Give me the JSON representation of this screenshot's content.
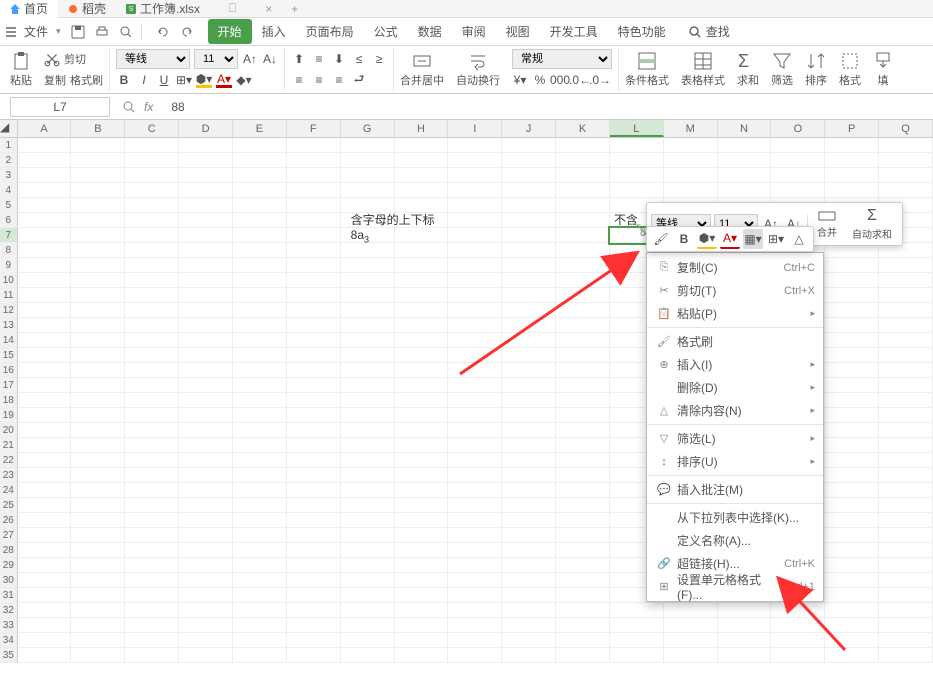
{
  "tabs": {
    "home": "首页",
    "daoke": "稻壳",
    "workbook": "工作簿.xlsx"
  },
  "menu": {
    "file": "文件",
    "tabs": [
      "开始",
      "插入",
      "页面布局",
      "公式",
      "数据",
      "审阅",
      "视图",
      "开发工具",
      "特色功能"
    ],
    "search": "查找"
  },
  "ribbon": {
    "paste": "粘贴",
    "cut": "剪切",
    "copy": "复制",
    "format_painter": "格式刷",
    "font_name": "等线",
    "font_size": "11",
    "number_format": "常规",
    "merge_center": "合并居中",
    "auto_wrap": "自动换行",
    "cond_format": "条件格式",
    "table_style": "表格样式",
    "sum": "求和",
    "filter": "筛选",
    "sort": "排序",
    "format": "格式",
    "fill": "填"
  },
  "formula_bar": {
    "name_box": "L7",
    "value": "88"
  },
  "columns": [
    "A",
    "B",
    "C",
    "D",
    "E",
    "F",
    "G",
    "H",
    "I",
    "J",
    "K",
    "L",
    "M",
    "N",
    "O",
    "P",
    "Q"
  ],
  "selected_col": "L",
  "selected_row": 7,
  "cells": {
    "G6": "含字母的上下标",
    "G7_prefix": "8a",
    "G7_sub": "3",
    "L6": "不含",
    "L7_display": "88|"
  },
  "mini_toolbar": {
    "font_name": "等线",
    "font_size": "11",
    "merge": "合并",
    "autosum": "自动求和"
  },
  "context_menu": {
    "items": [
      {
        "icon": "copy",
        "label": "复制(C)",
        "shortcut": "Ctrl+C"
      },
      {
        "icon": "cut",
        "label": "剪切(T)",
        "shortcut": "Ctrl+X"
      },
      {
        "icon": "paste",
        "label": "粘贴(P)",
        "arrow": true
      },
      {
        "divider": true
      },
      {
        "icon": "brush",
        "label": "格式刷"
      },
      {
        "icon": "insert",
        "label": "插入(I)",
        "arrow": true
      },
      {
        "icon": "",
        "label": "删除(D)",
        "arrow": true
      },
      {
        "icon": "clear",
        "label": "清除内容(N)",
        "arrow": true
      },
      {
        "divider": true
      },
      {
        "icon": "filter",
        "label": "筛选(L)",
        "arrow": true
      },
      {
        "icon": "sort",
        "label": "排序(U)",
        "arrow": true
      },
      {
        "divider": true
      },
      {
        "icon": "comment",
        "label": "插入批注(M)"
      },
      {
        "divider": true
      },
      {
        "icon": "",
        "label": "从下拉列表中选择(K)..."
      },
      {
        "icon": "",
        "label": "定义名称(A)..."
      },
      {
        "icon": "link",
        "label": "超链接(H)...",
        "shortcut": "Ctrl+K"
      },
      {
        "icon": "format",
        "label": "设置单元格格式(F)...",
        "shortcut": "Ctrl+1"
      }
    ]
  }
}
